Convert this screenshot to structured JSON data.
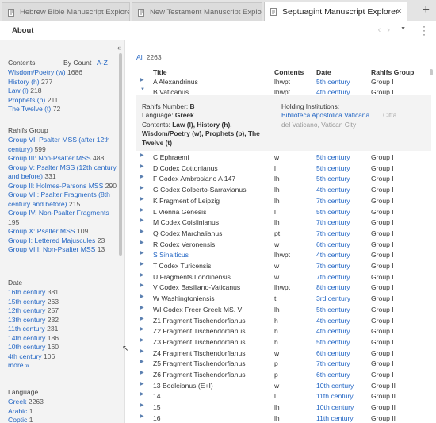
{
  "tabs": [
    {
      "label": "Hebrew Bible Manuscript Explorer",
      "active": false
    },
    {
      "label": "New Testament Manuscript Explorer",
      "active": false
    },
    {
      "label": "Septuagint Manuscript Explorer",
      "active": true
    }
  ],
  "toolbar": {
    "about_label": "About"
  },
  "sidebar": {
    "contents": {
      "heading": "Contents",
      "sort_by_count": "By Count",
      "sort_az": "A-Z",
      "items": [
        {
          "label": "Wisdom/Poetry (w)",
          "count": "1686"
        },
        {
          "label": "History (h)",
          "count": "277"
        },
        {
          "label": "Law (l)",
          "count": "218"
        },
        {
          "label": "Prophets (p)",
          "count": "211"
        },
        {
          "label": "The Twelve (t)",
          "count": "72"
        }
      ]
    },
    "rahlfs": {
      "heading": "Rahlfs Group",
      "items": [
        {
          "label": "Group VI: Psalter MSS (after 12th century)",
          "count": "599"
        },
        {
          "label": "Group III: Non-Psalter MSS",
          "count": "488"
        },
        {
          "label": "Group V: Psalter MSS (12th century and before)",
          "count": "331"
        },
        {
          "label": "Group II: Holmes-Parsons MSS",
          "count": "290"
        },
        {
          "label": "Group VII: Psalter Fragments (8th century and before)",
          "count": "215"
        },
        {
          "label": "Group IV: Non-Psalter Fragments",
          "count": "195"
        },
        {
          "label": "Group X: Psalter MSS",
          "count": "109"
        },
        {
          "label": "Group I: Lettered Majuscules",
          "count": "23"
        },
        {
          "label": "Group VIII: Non-Psalter MSS",
          "count": "13"
        }
      ]
    },
    "date": {
      "heading": "Date",
      "items": [
        {
          "label": "16th century",
          "count": "381"
        },
        {
          "label": "15th century",
          "count": "263"
        },
        {
          "label": "12th century",
          "count": "257"
        },
        {
          "label": "13th century",
          "count": "232"
        },
        {
          "label": "11th century",
          "count": "231"
        },
        {
          "label": "14th century",
          "count": "186"
        },
        {
          "label": "10th century",
          "count": "160"
        },
        {
          "label": "4th century",
          "count": "106"
        }
      ],
      "more": "more »"
    },
    "language": {
      "heading": "Language",
      "items": [
        {
          "label": "Greek",
          "count": "2263"
        },
        {
          "label": "Arabic",
          "count": "1"
        },
        {
          "label": "Coptic",
          "count": "1"
        }
      ]
    }
  },
  "main": {
    "all_label": "All",
    "all_count": "2263",
    "columns": {
      "title": "Title",
      "contents": "Contents",
      "date": "Date",
      "rahlfs": "Rahlfs Group"
    },
    "rows_top": [
      {
        "title": "A Alexandrinus",
        "contents": "lhwpt",
        "date": "5th century",
        "group": "Group I",
        "expanded": false
      },
      {
        "title": "B Vaticanus",
        "contents": "lhwpt",
        "date": "4th century",
        "group": "Group I",
        "expanded": true
      }
    ],
    "detail": {
      "rahlfs_label": "Rahlfs Number:",
      "rahlfs_value": "B",
      "language_label": "Language:",
      "language_value": "Greek",
      "contents_label": "Contents:",
      "contents_value": "Law (l), History (h), Wisdom/Poetry (w), Prophets (p), The Twelve (t)",
      "holding_label": "Holding Institutions:",
      "holding_value": "Biblioteca Apostolica Vaticana",
      "holding_place": "del Vaticano, Vatican City",
      "holding_city": "Città"
    },
    "rows": [
      {
        "title": "C Ephraemi",
        "contents": "w",
        "date": "5th century",
        "group": "Group I"
      },
      {
        "title": "D Codex Cottonianus",
        "contents": "l",
        "date": "5th century",
        "group": "Group I"
      },
      {
        "title": "F Codex Ambrosiano A 147",
        "contents": "lh",
        "date": "5th century",
        "group": "Group I"
      },
      {
        "title": "G Codex Colberto-Sarravianus",
        "contents": "lh",
        "date": "4th century",
        "group": "Group I"
      },
      {
        "title": "K Fragment of Leipzig",
        "contents": "lh",
        "date": "7th century",
        "group": "Group I"
      },
      {
        "title": "L Vienna Genesis",
        "contents": "l",
        "date": "5th century",
        "group": "Group I"
      },
      {
        "title": "M Codex Coislinianus",
        "contents": "lh",
        "date": "7th century",
        "group": "Group I"
      },
      {
        "title": "Q Codex Marchalianus",
        "contents": "pt",
        "date": "7th century",
        "group": "Group I"
      },
      {
        "title": "R Codex Veronensis",
        "contents": "w",
        "date": "6th century",
        "group": "Group I"
      },
      {
        "title": "S Sinaiticus",
        "contents": "lhwpt",
        "date": "4th century",
        "group": "Group I",
        "selected": true
      },
      {
        "title": "T Codex Turicensis",
        "contents": "w",
        "date": "7th century",
        "group": "Group I"
      },
      {
        "title": "U Fragments Londinensis",
        "contents": "w",
        "date": "7th century",
        "group": "Group I"
      },
      {
        "title": "V Codex Basiliano-Vaticanus",
        "contents": "lhwpt",
        "date": "8th century",
        "group": "Group I"
      },
      {
        "title": "W Washingtoniensis",
        "contents": "t",
        "date": "3rd century",
        "group": "Group I"
      },
      {
        "title": "WI Codex Freer Greek MS. V",
        "contents": "lh",
        "date": "5th century",
        "group": "Group I"
      },
      {
        "title": "Z1 Fragment Tischendorfianus",
        "contents": "h",
        "date": "4th century",
        "group": "Group I"
      },
      {
        "title": "Z2 Fragment Tischendorfianus",
        "contents": "h",
        "date": "4th century",
        "group": "Group I"
      },
      {
        "title": "Z3 Fragment Tischendorfianus",
        "contents": "h",
        "date": "5th century",
        "group": "Group I"
      },
      {
        "title": "Z4 Fragment Tischendorfianus",
        "contents": "w",
        "date": "6th century",
        "group": "Group I"
      },
      {
        "title": "Z5 Fragment Tischendorfianus",
        "contents": "p",
        "date": "7th century",
        "group": "Group I"
      },
      {
        "title": "Z6 Fragment Tischendorfianus",
        "contents": "p",
        "date": "6th century",
        "group": "Group I"
      },
      {
        "title": "13 Bodleianus (E+I)",
        "contents": "w",
        "date": "10th century",
        "group": "Group II"
      },
      {
        "title": "14",
        "contents": "l",
        "date": "11th century",
        "group": "Group II"
      },
      {
        "title": "15",
        "contents": "lh",
        "date": "10th century",
        "group": "Group II"
      },
      {
        "title": "16",
        "contents": "lh",
        "date": "11th century",
        "group": "Group II"
      }
    ]
  }
}
